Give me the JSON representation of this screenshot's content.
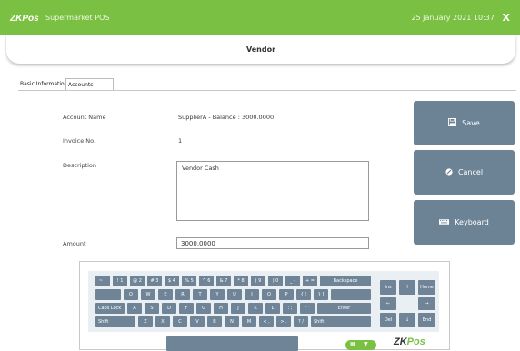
{
  "header": {
    "logo": "ZKPos",
    "app_title": "Supermarket POS",
    "datetime": "25 January 2021 10:37",
    "close_label": "X"
  },
  "page": {
    "title": "Vendor"
  },
  "tabs": [
    {
      "label": "Basic Information"
    },
    {
      "label": "Accounts",
      "active": true
    }
  ],
  "form": {
    "account_name_label": "Account Name",
    "account_name_value": "SupplierA - Balance : 3000.0000",
    "invoice_no_label": "Invoice No.",
    "invoice_no_value": "1",
    "description_label": "Description",
    "description_value": "Vendor Cash",
    "amount_label": "Amount",
    "amount_value": "3000.0000"
  },
  "actions": {
    "save_label": "Save",
    "cancel_label": "Cancel",
    "keyboard_label": "Keyboard"
  },
  "keyboard": {
    "row1": [
      "~ `",
      "! 1",
      "@ 2",
      "# 3",
      "$ 4",
      "% 5",
      "^ 6",
      "& 7",
      "* 8",
      "( 9",
      ") 0",
      "_ -",
      "+ =",
      "Backspace"
    ],
    "row2": [
      "Q",
      "W",
      "E",
      "R",
      "T",
      "Y",
      "U",
      "I",
      "O",
      "P",
      "{ [",
      "} ]"
    ],
    "row3": [
      "Caps Lock",
      "A",
      "S",
      "D",
      "F",
      "G",
      "H",
      "J",
      "K",
      "L",
      ": ;",
      "\" '",
      "Enter"
    ],
    "row4": [
      "Shift",
      "Z",
      "X",
      "C",
      "V",
      "B",
      "N",
      "M",
      "< ,",
      "> .",
      "? /",
      "Shift"
    ],
    "nav": {
      "ins": "Ins",
      "up": "↑",
      "home": "Home",
      "left": "←",
      "right": "→",
      "del": "Del",
      "down": "↓",
      "end": "End"
    },
    "logo_text": "ZK",
    "logo_accent": "Pos"
  },
  "colors": {
    "brand_green": "#7ac143",
    "button_slate": "#6c8295"
  }
}
